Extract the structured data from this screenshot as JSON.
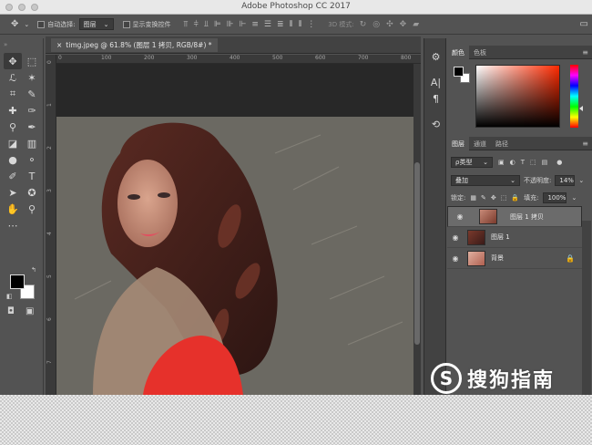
{
  "window": {
    "title": "Adobe Photoshop CC 2017"
  },
  "options_bar": {
    "auto_select_label": "自动选择:",
    "auto_select_value": "图层",
    "show_transform_label": "显示变换控件",
    "mode_3d_label": "3D 模式:"
  },
  "document": {
    "tab_title": "timg.jpeg @ 61.8% (图层 1 拷贝, RGB/8#) *",
    "ruler_top": [
      "0",
      "100",
      "200",
      "300",
      "400",
      "500",
      "600",
      "700",
      "800"
    ],
    "ruler_left": [
      "0",
      "1",
      "2",
      "3",
      "4",
      "5",
      "6",
      "7"
    ],
    "canvas_bg": "#282828",
    "image_bg": "#6b6962"
  },
  "panels": {
    "color_tabs": [
      "颜色",
      "色板"
    ],
    "layer_tabs": [
      "图层",
      "通道",
      "路径"
    ],
    "filter_label": "ρ类型",
    "blend_mode": "叠加",
    "opacity_label": "不透明度:",
    "opacity_value": "14%",
    "lock_label": "锁定:",
    "fill_label": "填充:",
    "fill_value": "100%",
    "layers": [
      {
        "name": "图层 1 拷贝",
        "selected": true,
        "locked": false
      },
      {
        "name": "图层 1",
        "selected": false,
        "locked": false
      },
      {
        "name": "背景",
        "selected": false,
        "locked": true
      }
    ]
  },
  "colors": {
    "foreground": "#000000",
    "background": "#ffffff",
    "accent": "#ff2a00"
  },
  "watermark": {
    "symbol": "S",
    "text": "搜狗指南"
  }
}
